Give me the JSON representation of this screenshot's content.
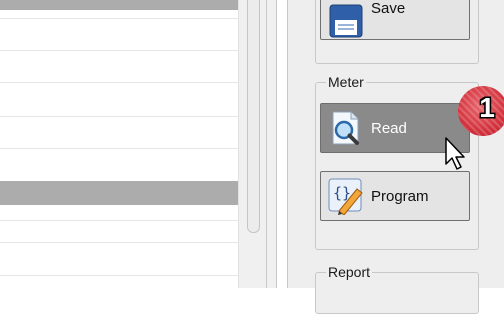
{
  "ribbon": {
    "save_button": {
      "label": "Save",
      "icon": "save-icon"
    },
    "meter_group": {
      "title": "Meter",
      "read_button": {
        "label": "Read",
        "icon": "magnifier-document-icon",
        "state": "hover"
      },
      "program_button": {
        "label": "Program",
        "icon": "code-pencil-icon"
      }
    },
    "report_group": {
      "title": "Report"
    }
  },
  "callout": {
    "number": "1",
    "color": "#d3323d"
  },
  "colors": {
    "selected_row": "#acacac",
    "button_hover": "#8a8a8a"
  }
}
